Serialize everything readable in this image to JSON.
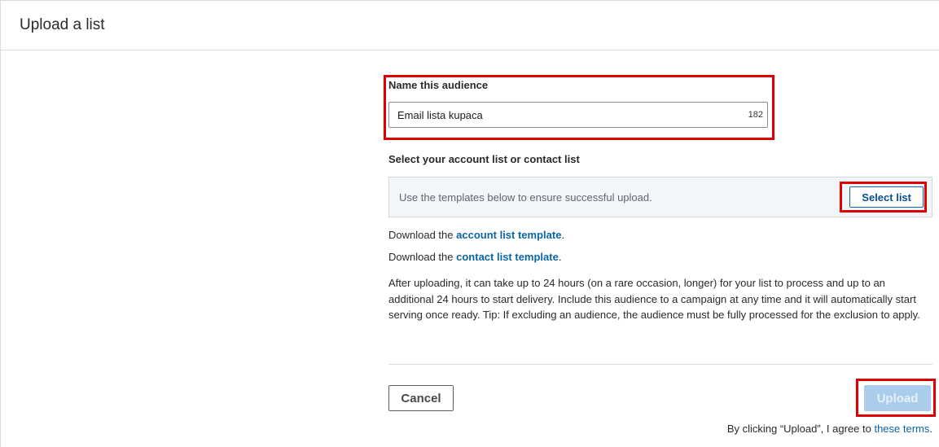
{
  "header": {
    "title": "Upload a list"
  },
  "name_section": {
    "label": "Name this audience",
    "value": "Email lista kupaca",
    "char_count": "182"
  },
  "list_section": {
    "label": "Select your account list or contact list",
    "hint": "Use the templates below to ensure successful upload.",
    "select_button": "Select list"
  },
  "downloads": {
    "prefix": "Download the ",
    "account_link": "account list template",
    "contact_link": "contact list template",
    "suffix": "."
  },
  "info_text": "After uploading, it can take up to 24 hours (on a rare occasion, longer) for your list to process and up to an additional 24 hours to start delivery. Include this audience to a campaign at any time and it will automatically start serving once ready. Tip: If excluding an audience, the audience must be fully processed for the exclusion to apply.",
  "footer": {
    "cancel_label": "Cancel",
    "upload_label": "Upload",
    "terms_prefix": "By clicking “Upload”, I agree to ",
    "terms_link": "these terms",
    "terms_suffix": "."
  },
  "colors": {
    "highlight": "#e00000",
    "link": "#0a66a2",
    "upload_disabled": "#a9cdea"
  }
}
